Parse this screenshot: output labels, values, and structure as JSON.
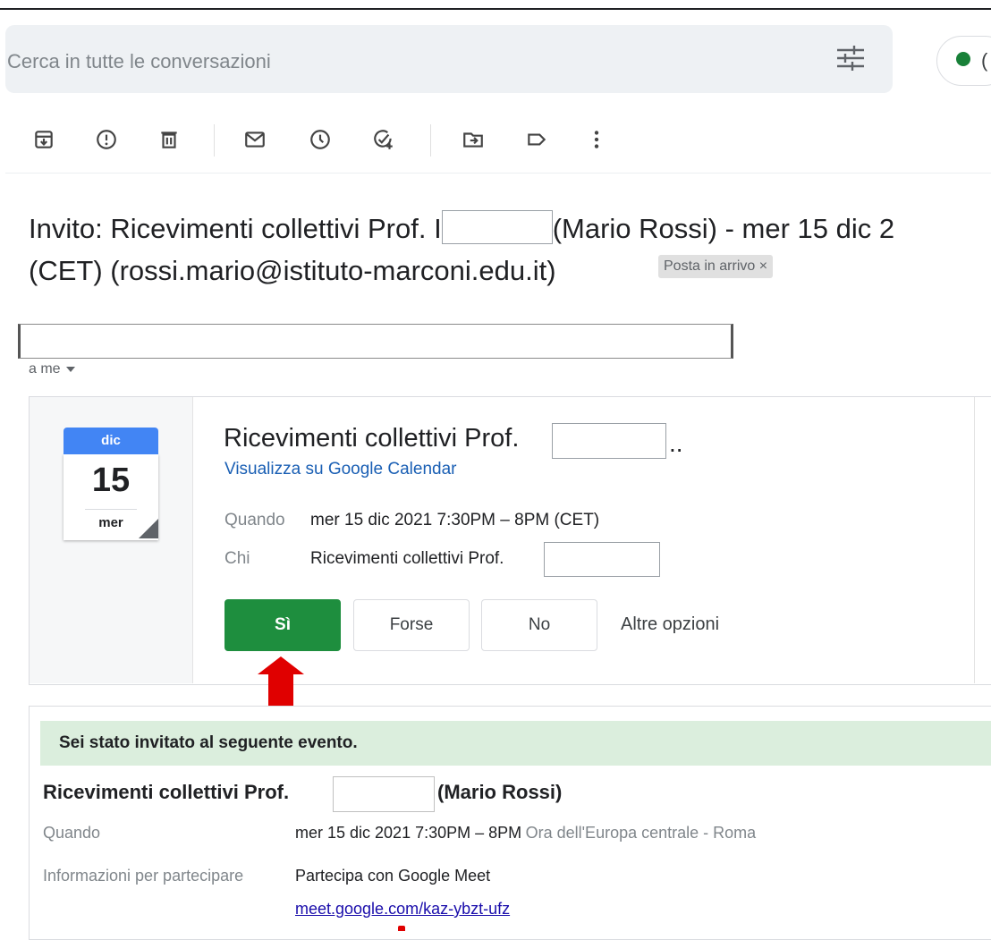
{
  "search": {
    "placeholder": "Cerca in tutte le conversazioni",
    "status_text": "(",
    "icons": [
      "tune-icon"
    ]
  },
  "toolbar": {
    "icons": [
      "archive-icon",
      "report-spam-icon",
      "delete-icon",
      "mark-unread-icon",
      "snooze-icon",
      "add-task-icon",
      "move-to-icon",
      "label-icon",
      "more-vert-icon"
    ]
  },
  "subject": {
    "line1_prefix": "Invito: Ricevimenti collettivi Prof. I",
    "line1_suffix": "(Mario Rossi) - mer 15 dic 2",
    "line2": "(CET) (rossi.mario@istituto-marconi.edu.it)",
    "label_chip": "Posta in arrivo",
    "label_chip_close": "×"
  },
  "sender": {
    "to_me": "a me"
  },
  "invite": {
    "calendar": {
      "month": "dic",
      "day": "15",
      "weekday": "mer"
    },
    "title": "Ricevimenti collettivi Prof.",
    "title_ellipsis": "..",
    "view_link": "Visualizza su Google Calendar",
    "when_label": "Quando",
    "when_value": "mer 15 dic 2021 7:30PM – 8PM (CET)",
    "who_label": "Chi",
    "who_value": "Ricevimenti collettivi Prof.",
    "buttons": {
      "yes": "Sì",
      "maybe": "Forse",
      "no": "No",
      "more": "Altre opzioni"
    }
  },
  "details": {
    "banner": "Sei stato invitato al seguente evento.",
    "title": "Ricevimenti collettivi Prof.",
    "title_name": "(Mario Rossi)",
    "when_label": "Quando",
    "when_value": "mer 15 dic 2021 7:30PM – 8PM",
    "when_tz": "Ora dell'Europa centrale - Roma",
    "join_label": "Informazioni per partecipare",
    "join_value": "Partecipa con Google Meet",
    "meet_link": "meet.google.com/kaz-ybzt-ufz"
  },
  "colors": {
    "accept_green": "#1e8e3e",
    "banner_green": "#dbeedd",
    "calendar_blue": "#4285f4",
    "annotation_red": "#e00000",
    "link_blue": "#1a5fb4"
  }
}
